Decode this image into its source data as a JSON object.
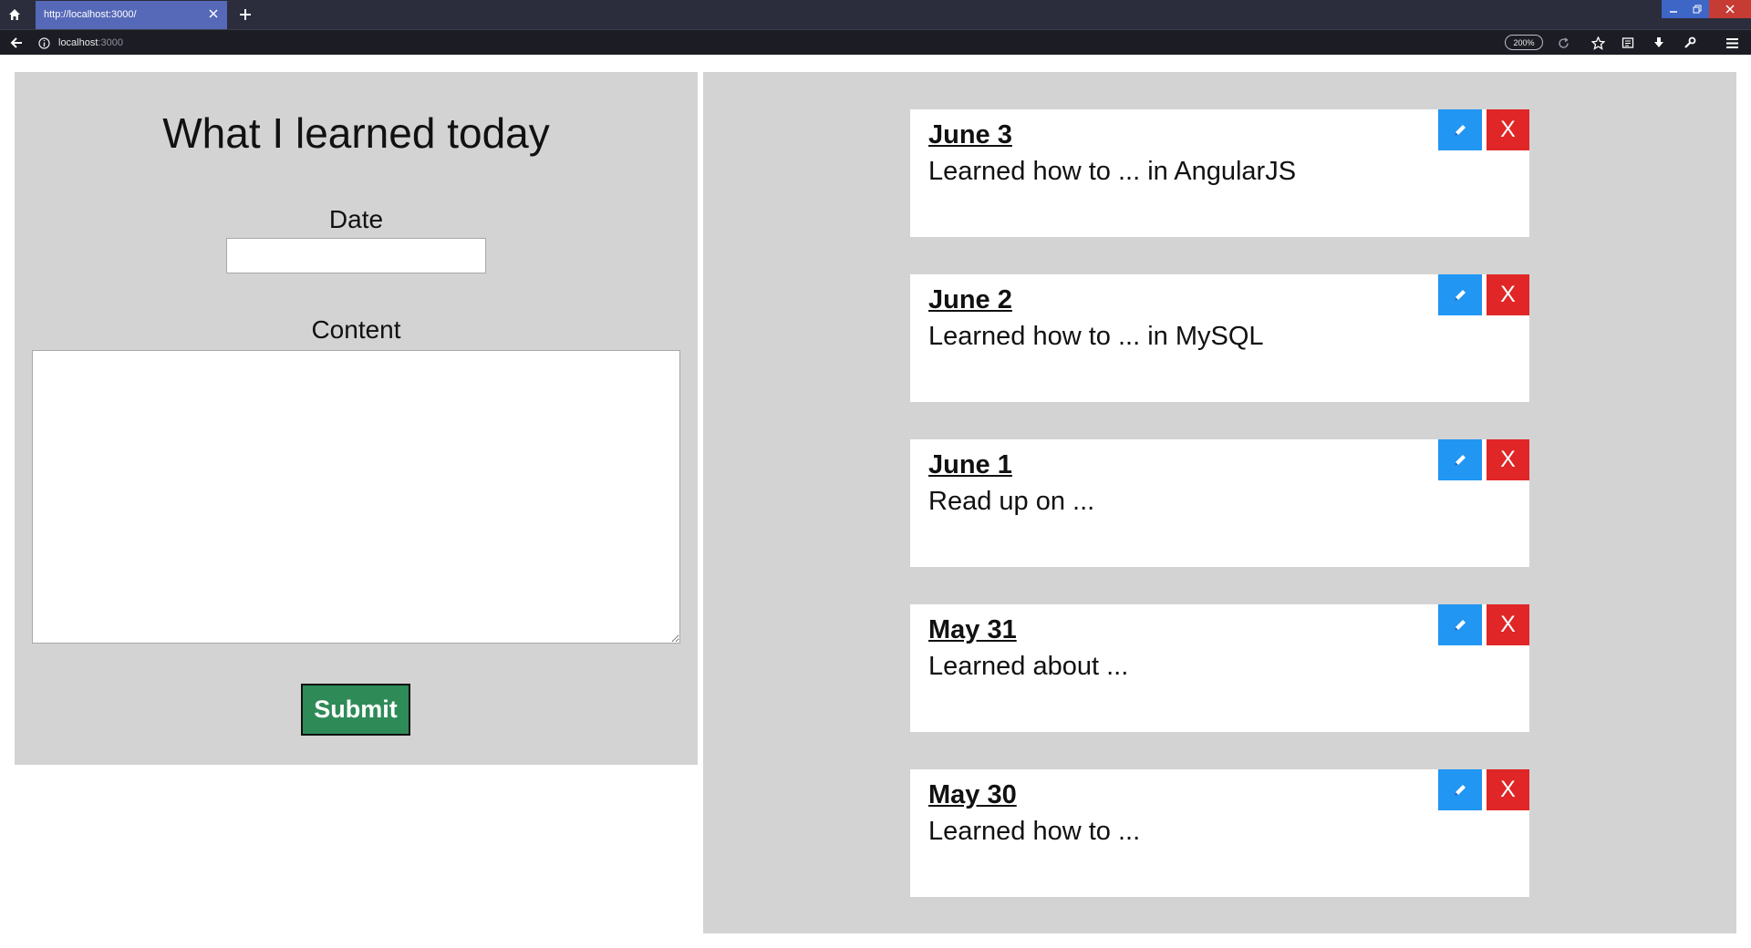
{
  "browser": {
    "tab_title": "http://localhost:3000/",
    "url_host": "localhost",
    "url_port": ":3000",
    "zoom": "200%"
  },
  "form": {
    "title": "What I learned today",
    "date_label": "Date",
    "date_value": "",
    "content_label": "Content",
    "content_value": "",
    "submit_label": "Submit"
  },
  "entries": [
    {
      "date": "June 3",
      "text": "Learned how to ... in AngularJS"
    },
    {
      "date": "June 2",
      "text": "Learned how to ... in MySQL"
    },
    {
      "date": "June 1",
      "text": "Read up on ..."
    },
    {
      "date": "May 31",
      "text": "Learned about ..."
    },
    {
      "date": "May 30",
      "text": "Learned how to ..."
    }
  ],
  "entry_buttons": {
    "delete_label": "X"
  },
  "colors": {
    "panel_bg": "#d3d3d3",
    "submit_bg": "#2e8b57",
    "edit_bg": "#2196f3",
    "delete_bg": "#e02626",
    "tab_active": "#5669b8"
  },
  "icons": {
    "home": "home-icon",
    "close_tab": "close-icon",
    "new_tab": "plus-icon",
    "back": "back-arrow-icon",
    "info": "info-icon",
    "reload": "reload-icon",
    "bookmark": "star-icon",
    "reader": "reader-icon",
    "download": "download-icon",
    "tools": "wrench-icon",
    "menu": "hamburger-icon",
    "edit": "pencil-icon"
  }
}
